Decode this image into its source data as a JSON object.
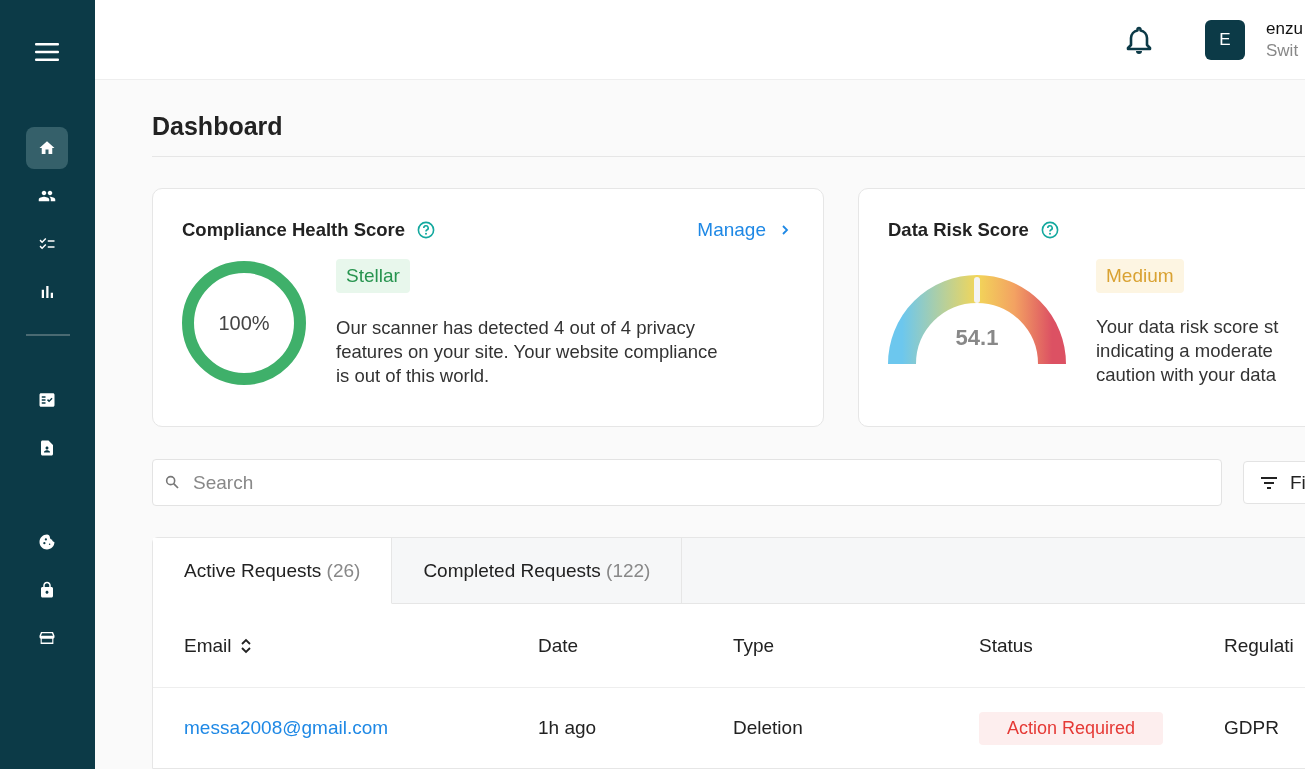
{
  "sidebar": {
    "items": [
      {
        "selected": true
      },
      {
        "selected": false
      },
      {
        "selected": false
      },
      {
        "selected": false
      },
      {
        "selected": false
      },
      {
        "selected": false
      },
      {
        "selected": false
      },
      {
        "selected": false
      },
      {
        "selected": false
      }
    ]
  },
  "header": {
    "avatar": "E",
    "user_name": "enzu",
    "user_sub": "Swit"
  },
  "page_title": "Dashboard",
  "compliance_card": {
    "title": "Compliance Health Score",
    "link": "Manage",
    "score": "100%",
    "level": 1,
    "badge": "Stellar",
    "text": "Our scanner has detected 4 out of 4 privacy features on your site. Your website compliance is out of this world."
  },
  "risk_card": {
    "title": "Data Risk Score",
    "score": "54.1",
    "level": 0.5,
    "badge": "Medium",
    "lines": [
      "Your data risk score st",
      "indicating a moderate",
      "caution with your data"
    ]
  },
  "search": {
    "placeholder": "Search"
  },
  "filter_button": "Fi",
  "tabs": [
    {
      "label": "Active Requests",
      "count": "(26)",
      "selected": true
    },
    {
      "label": "Completed Requests",
      "count": "(122)",
      "selected": false
    }
  ],
  "table": {
    "columns": [
      "Email",
      "Date",
      "Type",
      "Status",
      "Regulati"
    ],
    "rows": [
      {
        "email": "messa2008@gmail.com",
        "date": "1h ago",
        "type": "Deletion",
        "status": "Action Required",
        "regulation": "GDPR"
      }
    ]
  }
}
